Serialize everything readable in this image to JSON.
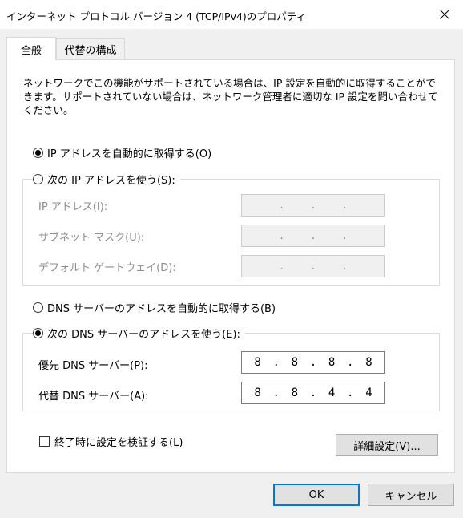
{
  "window": {
    "title": "インターネット プロトコル バージョン 4 (TCP/IPv4)のプロパティ",
    "close_icon": "close-icon"
  },
  "tabs": [
    {
      "label": "全般",
      "active": true
    },
    {
      "label": "代替の構成",
      "active": false
    }
  ],
  "description": "ネットワークでこの機能がサポートされている場合は、IP 設定を自動的に取得することができます。サポートされていない場合は、ネットワーク管理者に適切な IP 設定を問い合わせてください。",
  "ip_section": {
    "auto_label": "IP アドレスを自動的に取得する(O)",
    "auto_selected": true,
    "manual_label": "次の IP アドレスを使う(S):",
    "manual_selected": false,
    "fields": [
      {
        "label": "IP アドレス(I):",
        "octets": [
          "",
          "",
          "",
          ""
        ]
      },
      {
        "label": "サブネット マスク(U):",
        "octets": [
          "",
          "",
          "",
          ""
        ]
      },
      {
        "label": "デフォルト ゲートウェイ(D):",
        "octets": [
          "",
          "",
          "",
          ""
        ]
      }
    ]
  },
  "dns_section": {
    "auto_label": "DNS サーバーのアドレスを自動的に取得する(B)",
    "auto_selected": false,
    "manual_label": "次の DNS サーバーのアドレスを使う(E):",
    "manual_selected": true,
    "fields": [
      {
        "label": "優先 DNS サーバー(P):",
        "octets": [
          "8",
          "8",
          "8",
          "8"
        ]
      },
      {
        "label": "代替 DNS サーバー(A):",
        "octets": [
          "8",
          "8",
          "4",
          "4"
        ]
      }
    ]
  },
  "validate_checkbox": {
    "label": "終了時に設定を検証する(L)",
    "checked": false
  },
  "advanced_button": "詳細設定(V)...",
  "ok_button": "OK",
  "cancel_button": "キャンセル"
}
